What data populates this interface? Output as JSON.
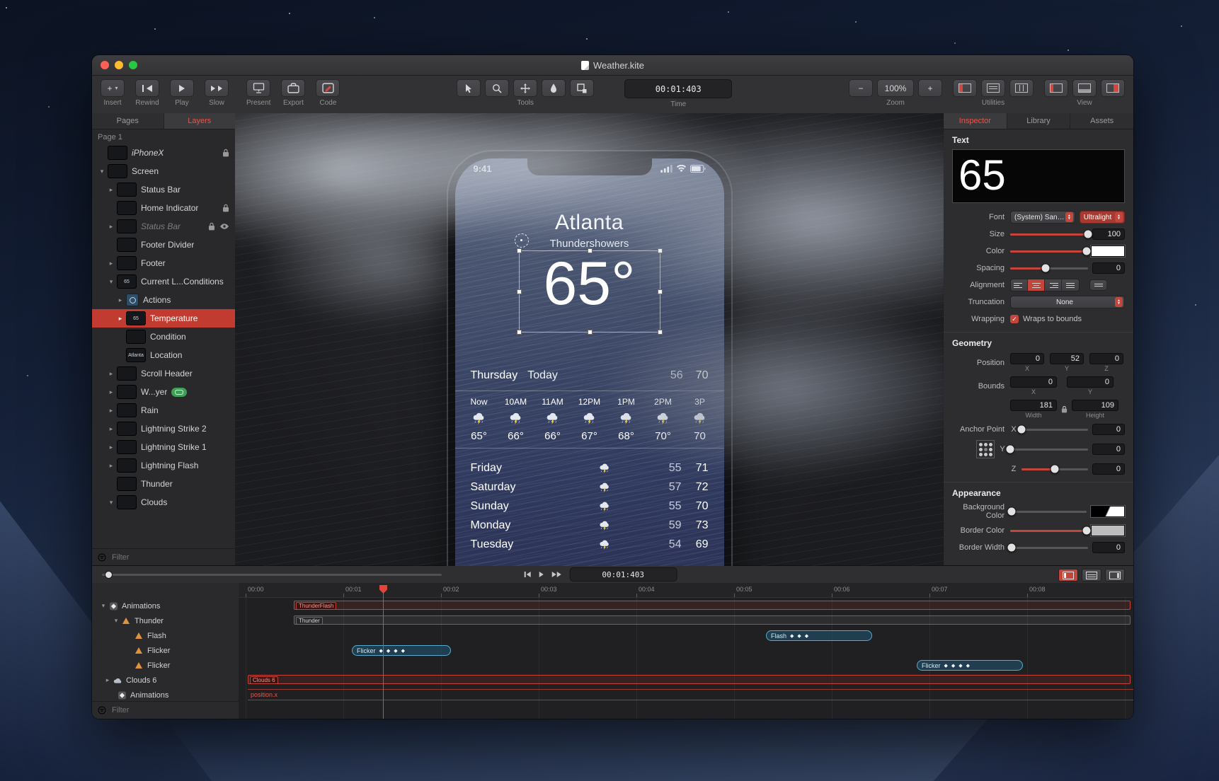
{
  "window": {
    "title": "Weather.kite"
  },
  "toolbar": {
    "insert_label": "Insert",
    "insert_plus": "+",
    "rewind_label": "Rewind",
    "play_label": "Play",
    "slow_label": "Slow",
    "present_label": "Present",
    "export_label": "Export",
    "code_label": "Code",
    "tools_label": "Tools",
    "time_label": "Time",
    "time_value": "00:01:403",
    "zoom_label": "Zoom",
    "zoom_value": "100%",
    "zoom_minus": "−",
    "zoom_plus": "+",
    "utilities_label": "Utilities",
    "view_label": "View"
  },
  "sidebar": {
    "tabs": [
      {
        "label": "Pages"
      },
      {
        "label": "Layers"
      }
    ],
    "page_label": "Page 1",
    "filter_label": "Filter",
    "layers": [
      {
        "label": "iPhoneX"
      },
      {
        "label": "Screen"
      },
      {
        "label": "Status Bar"
      },
      {
        "label": "Home Indicator"
      },
      {
        "label": "Status Bar"
      },
      {
        "label": "Footer Divider"
      },
      {
        "label": "Footer"
      },
      {
        "label": "Current L...Conditions",
        "thumb": "65"
      },
      {
        "label": "Actions"
      },
      {
        "label": "Temperature",
        "thumb": "65"
      },
      {
        "label": "Condition"
      },
      {
        "label": "Location",
        "thumb": "Atlanta"
      },
      {
        "label": "Scroll Header"
      },
      {
        "label": "W...yer"
      },
      {
        "label": "Rain"
      },
      {
        "label": "Lightning Strike 2"
      },
      {
        "label": "Lightning Strike 1"
      },
      {
        "label": "Lightning Flash"
      },
      {
        "label": "Thunder"
      },
      {
        "label": "Clouds"
      }
    ]
  },
  "phone": {
    "status_time": "9:41",
    "city": "Atlanta",
    "condition": "Thundershowers",
    "temperature": "65°",
    "today": {
      "day": "Thursday",
      "label": "Today",
      "low": "56",
      "high": "70"
    },
    "hourly": [
      {
        "time": "Now",
        "temp": "65°"
      },
      {
        "time": "10AM",
        "temp": "66°"
      },
      {
        "time": "11AM",
        "temp": "66°"
      },
      {
        "time": "12PM",
        "temp": "67°"
      },
      {
        "time": "1PM",
        "temp": "68°"
      },
      {
        "time": "2PM",
        "temp": "70°"
      },
      {
        "time": "3P",
        "temp": "70"
      }
    ],
    "daily": [
      {
        "day": "Friday",
        "low": "55",
        "high": "71"
      },
      {
        "day": "Saturday",
        "low": "57",
        "high": "72"
      },
      {
        "day": "Sunday",
        "low": "55",
        "high": "70"
      },
      {
        "day": "Monday",
        "low": "59",
        "high": "73"
      },
      {
        "day": "Tuesday",
        "low": "54",
        "high": "69"
      }
    ]
  },
  "inspector": {
    "tabs": [
      {
        "label": "Inspector"
      },
      {
        "label": "Library"
      },
      {
        "label": "Assets"
      }
    ],
    "text": {
      "title": "Text",
      "preview": "65",
      "font_label": "Font",
      "font_family": "(System) San…",
      "font_weight": "Ultralight",
      "size_label": "Size",
      "size_value": "100",
      "color_label": "Color",
      "spacing_label": "Spacing",
      "spacing_value": "0",
      "alignment_label": "Alignment",
      "truncation_label": "Truncation",
      "truncation_value": "None",
      "wrapping_label": "Wrapping",
      "wrapping_option": "Wraps to bounds"
    },
    "geometry": {
      "title": "Geometry",
      "position_label": "Position",
      "pos_x": "0",
      "pos_y": "52",
      "pos_z": "0",
      "x_axis": "X",
      "y_axis": "Y",
      "z_axis": "Z",
      "bounds_label": "Bounds",
      "bounds_x": "0",
      "bounds_y": "0",
      "width_label": "Width",
      "width_value": "181",
      "height_label": "Height",
      "height_value": "109",
      "anchor_label": "Anchor Point",
      "anchor_x": "0",
      "anchor_y": "0",
      "anchor_z": "0"
    },
    "appearance": {
      "title": "Appearance",
      "background_label": "Background Color",
      "border_color_label": "Border Color",
      "border_width_label": "Border Width",
      "border_width_value": "0"
    }
  },
  "timeline": {
    "time_value": "00:01:403",
    "filter_label": "Filter",
    "ruler": [
      "00:00",
      "00:01",
      "00:02",
      "00:03",
      "00:04",
      "00:05",
      "00:06",
      "00:07",
      "00:08"
    ],
    "tree": [
      {
        "label": "Animations"
      },
      {
        "label": "Thunder"
      },
      {
        "label": "Flash"
      },
      {
        "label": "Flicker"
      },
      {
        "label": "Flicker"
      },
      {
        "label": "Clouds 6"
      },
      {
        "label": "Animations"
      }
    ],
    "bars": {
      "thunderflash": "ThunderFlash",
      "thunder": "Thunder",
      "flash": "Flash",
      "flicker1": "Flicker",
      "flicker2": "Flicker",
      "clouds": "Clouds 6",
      "positionx": "position.x"
    }
  }
}
